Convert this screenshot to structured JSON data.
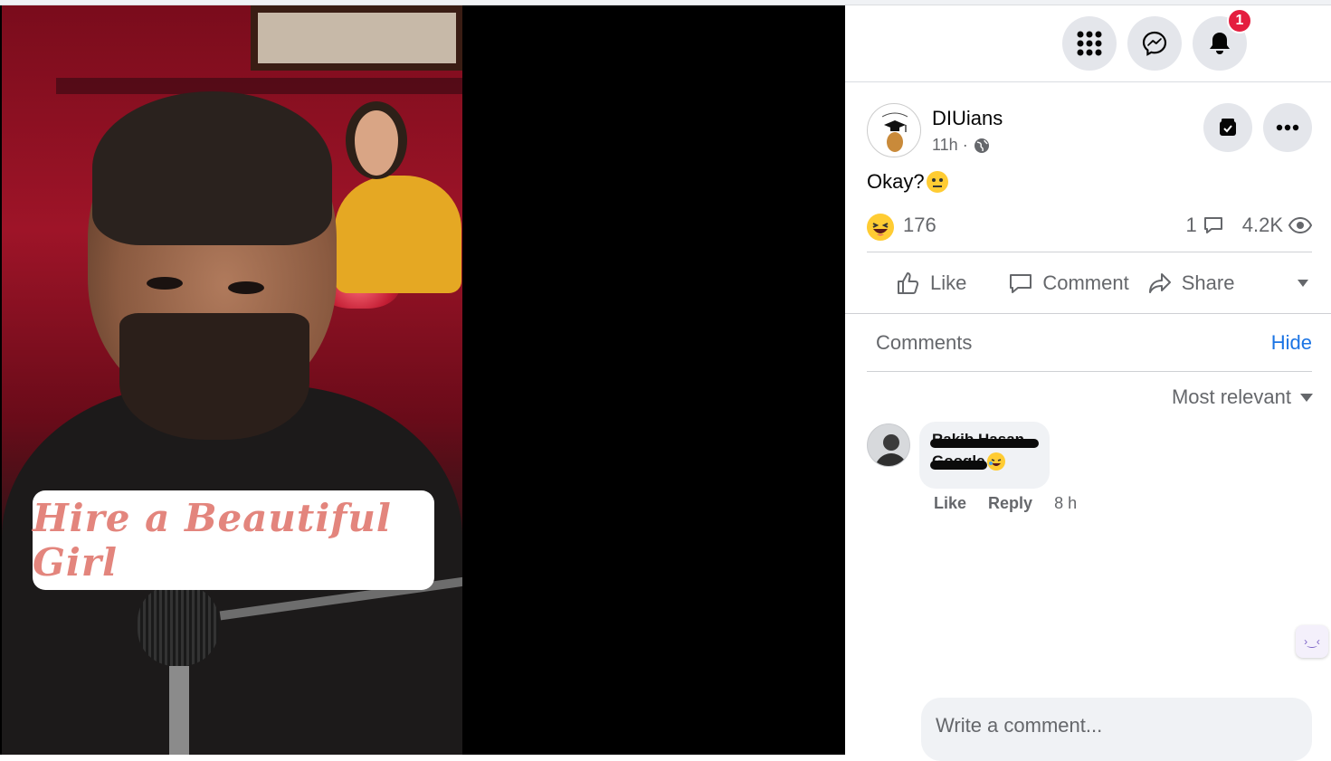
{
  "video": {
    "caption_overlay": "Hire a Beautiful Girl"
  },
  "topbar": {
    "menu_icon": "grid-menu-icon",
    "messenger_icon": "messenger-icon",
    "notifications_icon": "bell-icon",
    "notification_count": "1"
  },
  "post": {
    "page_name": "DIUians",
    "time": "11h ·",
    "text": "Okay?",
    "reaction_count": "176",
    "comment_count": "1",
    "view_count": "4.2K"
  },
  "actions": {
    "like": "Like",
    "comment": "Comment",
    "share": "Share"
  },
  "comments": {
    "header": "Comments",
    "hide": "Hide",
    "sort": "Most relevant",
    "items": [
      {
        "author": "Rakib Hasan",
        "text": "Google",
        "like": "Like",
        "reply": "Reply",
        "time": "8 h"
      }
    ],
    "input_placeholder": "Write a comment..."
  },
  "colors": {
    "accent": "#1b74e4",
    "badge": "#e41e3f",
    "muted": "#65676b"
  }
}
